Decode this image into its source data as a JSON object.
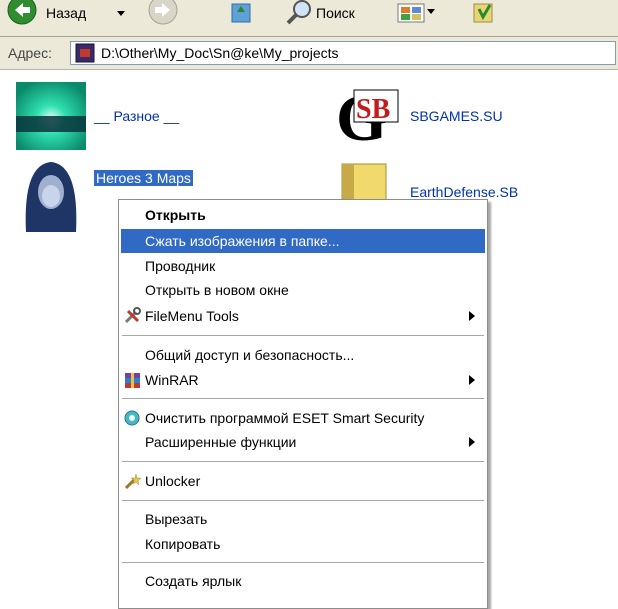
{
  "toolbar": {
    "back_label": "Назад",
    "search_label": "Поиск"
  },
  "address": {
    "label": "Адрес:",
    "path": "D:\\Other\\My_Doc\\Sn@ke\\My_projects"
  },
  "items": [
    {
      "label": "__ Разное __"
    },
    {
      "label": "SBGAMES.SU"
    },
    {
      "label": "Heroes 3 Maps"
    },
    {
      "label": "EarthDefense.SB"
    }
  ],
  "context_menu": {
    "open": "Открыть",
    "compress_images": "Сжать изображения в папке...",
    "explorer": "Проводник",
    "open_new_window": "Открыть в новом окне",
    "filemenu_tools": "FileMenu Tools",
    "sharing_security": "Общий доступ и безопасность...",
    "winrar": "WinRAR",
    "eset_scan": "Очистить программой ESET Smart Security",
    "advanced": "Расширенные функции",
    "unlocker": "Unlocker",
    "cut": "Вырезать",
    "copy": "Копировать",
    "create_shortcut": "Создать ярлык"
  },
  "colors": {
    "highlight": "#316ac5",
    "link": "#0033aa",
    "toolbar_bg": "#ece9d8"
  }
}
